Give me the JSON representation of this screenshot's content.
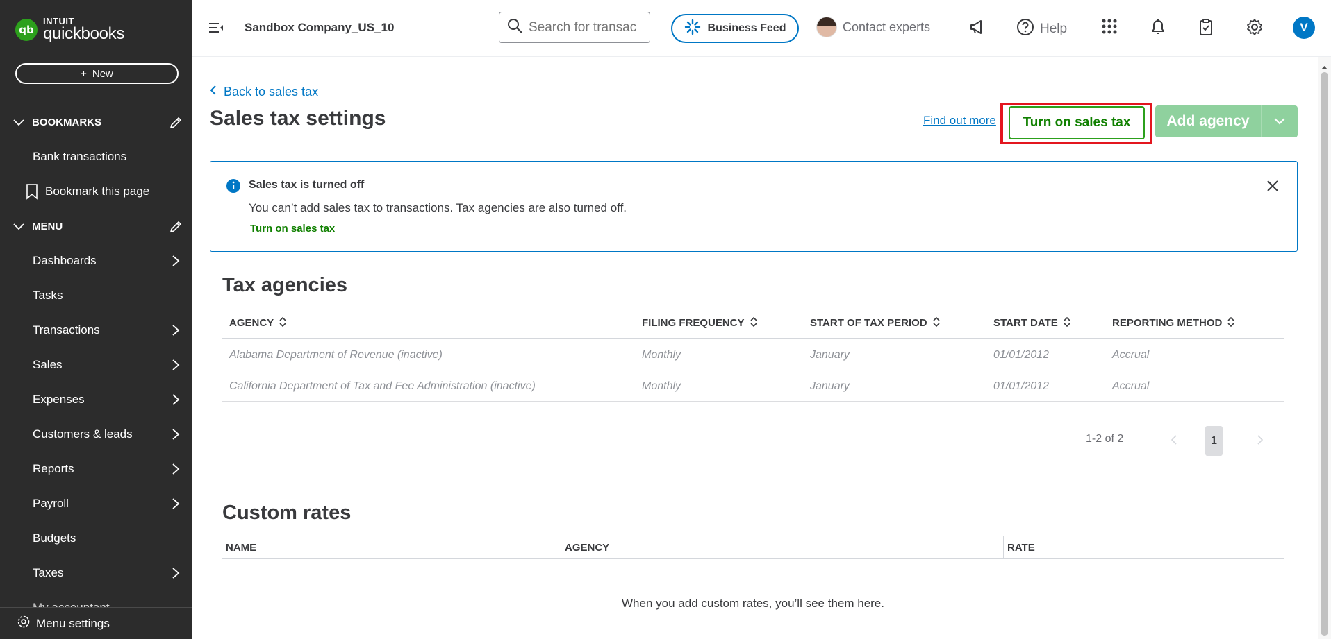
{
  "sidebar": {
    "logo_top": "INTUIT",
    "logo_bottom": "quickbooks",
    "new_label": "New",
    "bookmarks_header": "BOOKMARKS",
    "bookmarks": [
      {
        "label": "Bank transactions"
      },
      {
        "label": "Bookmark this page"
      }
    ],
    "menu_header": "MENU",
    "menu_items": [
      {
        "label": "Dashboards"
      },
      {
        "label": "Tasks"
      },
      {
        "label": "Transactions"
      },
      {
        "label": "Sales"
      },
      {
        "label": "Expenses"
      },
      {
        "label": "Customers & leads"
      },
      {
        "label": "Reports"
      },
      {
        "label": "Payroll"
      },
      {
        "label": "Budgets"
      },
      {
        "label": "Taxes"
      },
      {
        "label": "My accountant"
      }
    ],
    "menu_settings": "Menu settings"
  },
  "topbar": {
    "company": "Sandbox Company_US_10",
    "search_placeholder": "Search for transac",
    "business_feed": "Business Feed",
    "contact_experts": "Contact experts",
    "help": "Help",
    "user_initial": "V"
  },
  "page": {
    "back_link": "Back to sales tax",
    "title": "Sales tax settings",
    "find_out_more": "Find out more",
    "turn_on_button": "Turn on sales tax",
    "add_agency_button": "Add agency",
    "alert": {
      "title": "Sales tax is turned off",
      "body": "You can’t add sales tax to transactions. Tax agencies are also turned off.",
      "link": "Turn on sales tax"
    }
  },
  "agencies": {
    "title": "Tax agencies",
    "columns": [
      "AGENCY",
      "FILING FREQUENCY",
      "START OF TAX PERIOD",
      "START DATE",
      "REPORTING METHOD"
    ],
    "rows": [
      [
        "Alabama Department of Revenue (inactive)",
        "Monthly",
        "January",
        "01/01/2012",
        "Accrual"
      ],
      [
        "California Department of Tax and Fee Administration (inactive)",
        "Monthly",
        "January",
        "01/01/2012",
        "Accrual"
      ]
    ],
    "pager_count": "1-2 of 2",
    "current_page": "1"
  },
  "custom_rates": {
    "title": "Custom rates",
    "columns": [
      "NAME",
      "AGENCY",
      "RATE"
    ],
    "empty_message": "When you add custom rates, you’ll see them here."
  },
  "colors": {
    "sidebar_bg": "#2c2c2c",
    "brand_green": "#2ca01c",
    "link_blue": "#0077c5",
    "highlight_red": "#e3161f",
    "disabled_green": "#8fd19e"
  }
}
